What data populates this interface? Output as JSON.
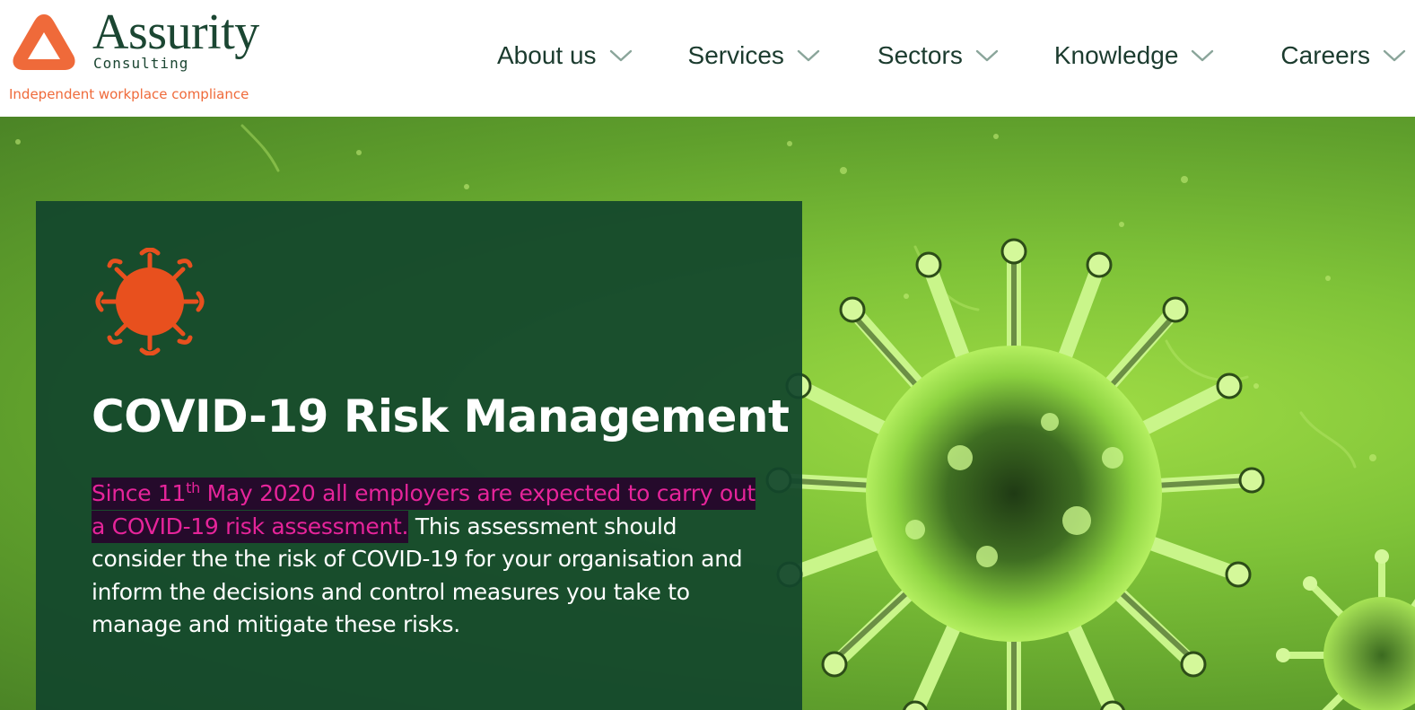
{
  "brand": {
    "name": "Assurity",
    "sub": "Consulting",
    "tagline": "Independent workplace compliance",
    "logo_icon": "triangle-logo-icon",
    "colors": {
      "brand_green": "#1b4632",
      "brand_orange": "#ef6a3a"
    }
  },
  "nav": {
    "items": [
      {
        "label": "About us",
        "icon": "chevron-down-icon"
      },
      {
        "label": "Services",
        "icon": "chevron-down-icon"
      },
      {
        "label": "Sectors",
        "icon": "chevron-down-icon"
      },
      {
        "label": "Knowledge",
        "icon": "chevron-down-icon"
      },
      {
        "label": "Careers",
        "icon": "chevron-down-icon"
      }
    ]
  },
  "hero": {
    "icon": "virus-icon",
    "title": "COVID-19 Risk Management",
    "highlight_prefix": "Since 11",
    "highlight_sup": "th",
    "highlight_suffix": " May 2020 all employers are expected to carry out a COVID-19 risk assessment.",
    "body": " This assessment should consider the the risk of COVID-19 for your organisation and inform the decisions and control measures you take to manage and mitigate these risks.",
    "colors": {
      "card_bg": "#12462c",
      "highlight_text": "#e6249a",
      "highlight_bg": "#250a2b",
      "virus_icon": "#e8501e"
    }
  }
}
